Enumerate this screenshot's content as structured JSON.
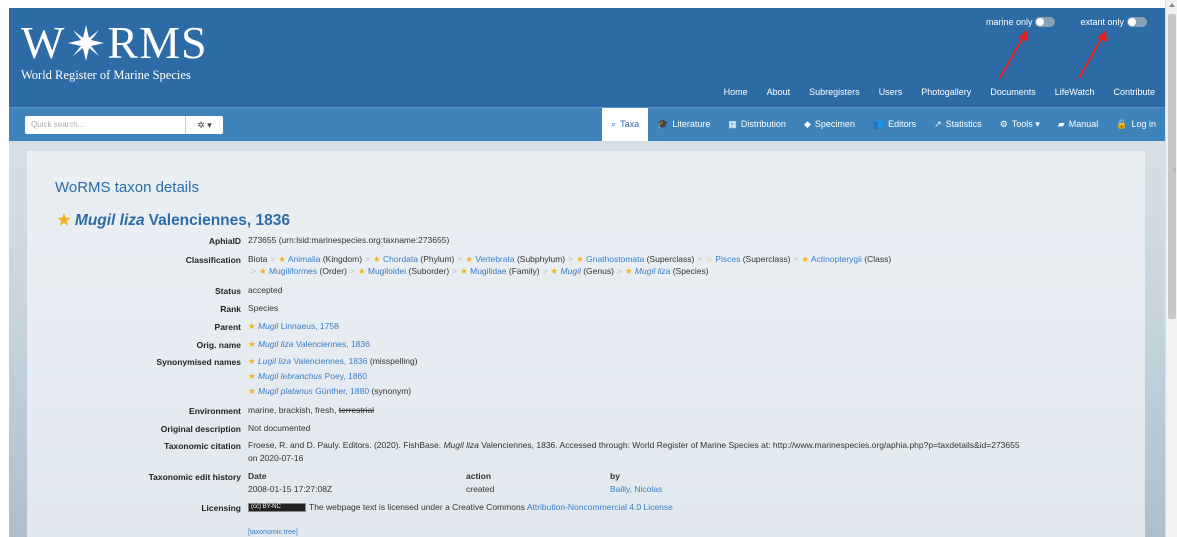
{
  "header": {
    "logo_word": "W",
    "logo_word2": "RMS",
    "logo_sub": "World Register of Marine Species",
    "toggles": [
      {
        "label": "marine only"
      },
      {
        "label": "extant only"
      }
    ],
    "nav": [
      "Home",
      "About",
      "Subregisters",
      "Users",
      "Photogallery",
      "Documents",
      "LifeWatch",
      "Contribute"
    ]
  },
  "navbar": {
    "search_placeholder": "Quick search...",
    "search_btn": "✲ ▾",
    "items": [
      {
        "icon": "⌕",
        "label": "Taxa",
        "active": true
      },
      {
        "icon": "🎓",
        "label": "Literature"
      },
      {
        "icon": "▦",
        "label": "Distribution"
      },
      {
        "icon": "◆",
        "label": "Specimen"
      },
      {
        "icon": "👥",
        "label": "Editors"
      },
      {
        "icon": "↗",
        "label": "Statistics"
      },
      {
        "icon": "⚙",
        "label": "Tools ▾"
      },
      {
        "icon": "▰",
        "label": "Manual"
      },
      {
        "icon": "🔒",
        "label": "Log in"
      }
    ]
  },
  "page_title": "WoRMS taxon details",
  "taxon": {
    "name": "Mugil liza",
    "author": "Valenciennes, 1836"
  },
  "details": {
    "aphia_label": "AphiaID",
    "aphia_value": "273655  (urn:lsid:marinespecies.org:taxname:273655)",
    "classification_label": "Classification",
    "classification_line1": [
      {
        "t": "Biota",
        "link": false,
        "star": false
      },
      {
        "t": "Animalia",
        "rank": "(Kingdom)",
        "link": true,
        "star": true
      },
      {
        "t": "Chordata",
        "rank": "(Phylum)",
        "link": true,
        "star": true
      },
      {
        "t": "Vertebrata",
        "rank": "(Subphylum)",
        "link": true,
        "star": true
      },
      {
        "t": "Gnathostomata",
        "rank": "(Superclass)",
        "link": true,
        "star": true
      },
      {
        "t": "Pisces",
        "rank": "(Superclass)",
        "link": true,
        "star": "outline"
      },
      {
        "t": "Actinopterygii",
        "rank": "(Class)",
        "link": true,
        "star": true
      }
    ],
    "classification_line2": [
      {
        "t": "Mugiliformes",
        "rank": "(Order)",
        "link": true,
        "star": true
      },
      {
        "t": "Mugiloidei",
        "rank": "(Suborder)",
        "link": true,
        "star": true
      },
      {
        "t": "Mugilidae",
        "rank": "(Family)",
        "link": true,
        "star": true
      },
      {
        "t": "Mugil",
        "rank": "(Genus)",
        "link": true,
        "star": true,
        "italic": true
      },
      {
        "t": "Mugil liza",
        "rank": "(Species)",
        "link": true,
        "star": true,
        "italic": true
      }
    ],
    "status_label": "Status",
    "status_value": "accepted",
    "rank_label": "Rank",
    "rank_value": "Species",
    "parent_label": "Parent",
    "parent_genus": "Mugil",
    "parent_author": "Linnaeus, 1758",
    "orig_label": "Orig. name",
    "orig_name": "Mugil liza",
    "orig_author": "Valenciennes, 1836",
    "syn_label": "Synonymised names",
    "synonyms": [
      {
        "name": "Lugil liza",
        "author": "Valenciennes, 1836",
        "note": "(misspelling)"
      },
      {
        "name": "Mugil lebranchus",
        "author": "Poey, 1860",
        "note": ""
      },
      {
        "name": "Mugil platanus",
        "author": "Günther, 1880",
        "note": "(synonym)"
      }
    ],
    "env_label": "Environment",
    "env_value": "marine, brackish, fresh, ",
    "env_struck": "terrestrial",
    "origdesc_label": "Original description",
    "origdesc_value": "Not documented",
    "citation_label": "Taxonomic citation",
    "citation_pre": "Froese, R. and D. Pauly. Editors. (2020). FishBase. ",
    "citation_italic": "Mugil liza",
    "citation_post": " Valenciennes, 1836. Accessed through: World Register of Marine Species at: http://www.marinespecies.org/aphia.php?p=taxdetails&id=273655",
    "citation_line2": "on 2020-07-16",
    "history_label": "Taxonomic edit history",
    "history_headers": [
      "Date",
      "action",
      "by"
    ],
    "history_rows": [
      [
        "2008-01-15 17:27:08Z",
        "created",
        "Bailly, Nicolas"
      ]
    ],
    "licensing_label": "Licensing",
    "cc_badge": "(cc) BY-NC",
    "licensing_text": "The webpage text is licensed under a Creative Commons ",
    "licensing_link": "Attribution-Noncommercial 4.0 License",
    "tree_link": "[taxonomic tree]"
  },
  "colors": {
    "header": "#2d6ba6",
    "navbar": "#3f83bb",
    "link": "#3a7cc8",
    "star": "#f0b21a",
    "arrow": "#e52020"
  }
}
